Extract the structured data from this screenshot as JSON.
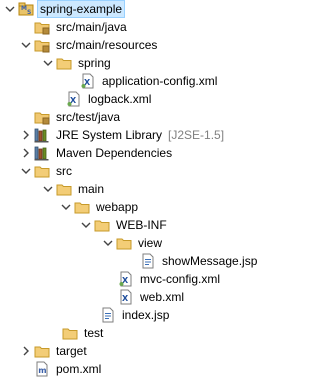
{
  "tree": [
    {
      "label": "spring-example",
      "icon": "maven-project-icon",
      "state": "expanded",
      "selected": true
    },
    {
      "label": "src/main/java",
      "icon": "package-folder-icon",
      "state": "leaf"
    },
    {
      "label": "src/main/resources",
      "icon": "package-folder-icon",
      "state": "expanded"
    },
    {
      "label": "spring",
      "icon": "folder-icon",
      "state": "expanded"
    },
    {
      "label": "application-config.xml",
      "icon": "xml-file-icon",
      "state": "leaf"
    },
    {
      "label": "logback.xml",
      "icon": "xml-file-icon",
      "state": "leaf"
    },
    {
      "label": "src/test/java",
      "icon": "package-folder-icon",
      "state": "leaf"
    },
    {
      "label": "JRE System Library",
      "decoration": "[J2SE-1.5]",
      "icon": "library-icon",
      "state": "collapsed"
    },
    {
      "label": "Maven Dependencies",
      "icon": "library-icon",
      "state": "collapsed"
    },
    {
      "label": "src",
      "icon": "folder-icon",
      "state": "expanded"
    },
    {
      "label": "main",
      "icon": "folder-icon",
      "state": "expanded"
    },
    {
      "label": "webapp",
      "icon": "folder-icon",
      "state": "expanded"
    },
    {
      "label": "WEB-INF",
      "icon": "folder-icon",
      "state": "expanded"
    },
    {
      "label": "view",
      "icon": "folder-icon",
      "state": "expanded"
    },
    {
      "label": "showMessage.jsp",
      "icon": "jsp-file-icon",
      "state": "leaf"
    },
    {
      "label": "mvc-config.xml",
      "icon": "xml-file-icon",
      "state": "leaf"
    },
    {
      "label": "web.xml",
      "icon": "xml-file-icon",
      "state": "leaf"
    },
    {
      "label": "index.jsp",
      "icon": "jsp-file-icon",
      "state": "leaf"
    },
    {
      "label": "test",
      "icon": "folder-icon",
      "state": "leaf"
    },
    {
      "label": "target",
      "icon": "folder-icon",
      "state": "collapsed"
    },
    {
      "label": "pom.xml",
      "icon": "maven-pom-icon",
      "state": "leaf"
    }
  ]
}
